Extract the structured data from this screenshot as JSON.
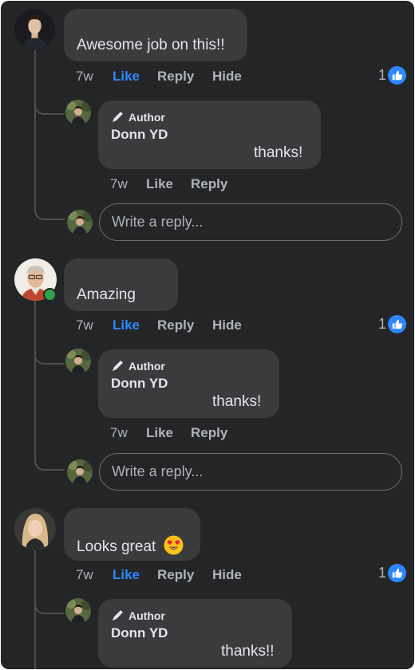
{
  "threads": [
    {
      "comment": "Awesome job on this!!",
      "time": "7w",
      "actions": [
        "Like",
        "Reply",
        "Hide"
      ],
      "reaction_count": "1",
      "reply": {
        "badge": "Author",
        "name": "Donn YD",
        "text": "thanks!",
        "time": "7w",
        "actions": [
          "Like",
          "Reply"
        ]
      },
      "input_placeholder": "Write a reply..."
    },
    {
      "comment": "Amazing",
      "time": "7w",
      "actions": [
        "Like",
        "Reply",
        "Hide"
      ],
      "reaction_count": "1",
      "reply": {
        "badge": "Author",
        "name": "Donn YD",
        "text": "thanks!",
        "time": "7w",
        "actions": [
          "Like",
          "Reply"
        ]
      },
      "input_placeholder": "Write a reply..."
    },
    {
      "comment": "Looks great",
      "comment_emoji": "heart-eyes-emoji",
      "time": "7w",
      "actions": [
        "Like",
        "Reply",
        "Hide"
      ],
      "reaction_count": "1",
      "reply": {
        "badge": "Author",
        "name": "Donn YD",
        "text": "thanks!!"
      }
    }
  ],
  "colors": {
    "background": "#242526",
    "bubble": "#3a3b3c",
    "text": "#e4e6eb",
    "muted": "#b0b3b8",
    "liked": "#2d88ff",
    "online": "#31a24c"
  }
}
